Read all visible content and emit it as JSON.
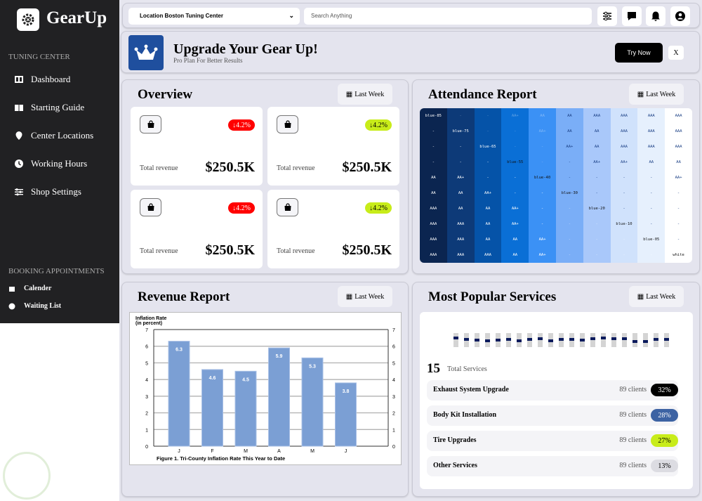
{
  "sidebar": {
    "brand": "GearUp",
    "section1": "TUNING CENTER",
    "items": [
      {
        "label": "Dashboard",
        "icon": "columns-icon"
      },
      {
        "label": "Starting Guide",
        "icon": "book-icon"
      },
      {
        "label": "Center Locations",
        "icon": "map-pin-icon"
      },
      {
        "label": "Working Hours",
        "icon": "clock-icon"
      },
      {
        "label": "Shop Settings",
        "icon": "sliders-icon"
      }
    ],
    "section2": "BOOKING APPOINTMENTS",
    "items2": [
      {
        "label": "Calender",
        "icon": "calendar-icon"
      },
      {
        "label": "Waiting List",
        "icon": "clock-icon"
      }
    ]
  },
  "header": {
    "location": "Location Boston Tuning Center",
    "search_placeholder": "Search Anything"
  },
  "banner": {
    "title": "Upgrade Your Gear Up!",
    "subtitle": "Pro Plan For Better Results",
    "try": "Try Now",
    "close": "X"
  },
  "filter_label": "Last Week",
  "overview": {
    "title": "Overview",
    "cards": [
      {
        "change": "4.2%",
        "color": "#ff0000",
        "text_color": "#ffffff",
        "label": "Total revenue",
        "value": "$250.5K"
      },
      {
        "change": "4.2%",
        "color": "#c8ec1a",
        "text_color": "#000000",
        "label": "Total revenue",
        "value": "$250.5K"
      },
      {
        "change": "4.2%",
        "color": "#ff0000",
        "text_color": "#ffffff",
        "label": "Total revenue",
        "value": "$250.5K"
      },
      {
        "change": "4.2%",
        "color": "#c8ec1a",
        "text_color": "#000000",
        "label": "Total revenue",
        "value": "$250.5K"
      }
    ]
  },
  "attendance": {
    "title": "Attendance Report",
    "column_colors": [
      "#0b2550",
      "#0d3a78",
      "#0553a8",
      "#0a6fd6",
      "#3b91f5",
      "#7aaef7",
      "#a9c8fa",
      "#d0e2fc",
      "#e6f0fd",
      "#ffffff"
    ],
    "rows": [
      [
        "blue-85",
        "-",
        "-",
        "AA+",
        "AA",
        "AA",
        "AAA",
        "AAA",
        "AAA",
        "AAA"
      ],
      [
        "-",
        "blue-75",
        "-",
        "-",
        "AA+",
        "AA",
        "AA",
        "AAA",
        "AAA",
        "AAA"
      ],
      [
        "-",
        "-",
        "blue-65",
        "-",
        "-",
        "AA+",
        "AA",
        "AAA",
        "AAA",
        "AAA"
      ],
      [
        "-",
        "-",
        "-",
        "blue-55",
        "-",
        "-",
        "AA+",
        "AA+",
        "AA",
        "AA"
      ],
      [
        "AA",
        "AA+",
        "-",
        "-",
        "blue-40",
        "-",
        "-",
        "-",
        "-",
        "AA+"
      ],
      [
        "AA",
        "AA",
        "AA+",
        "-",
        "-",
        "blue-30",
        "-",
        "-",
        "-",
        "-"
      ],
      [
        "AAA",
        "AA",
        "AA",
        "AA+",
        "-",
        "-",
        "blue-20",
        "-",
        "-",
        "-"
      ],
      [
        "AAA",
        "AAA",
        "AA",
        "AA+",
        "-",
        "-",
        "-",
        "blue-10",
        "-",
        "-"
      ],
      [
        "AAA",
        "AAA",
        "AA",
        "AA",
        "AA+",
        "-",
        "-",
        "-",
        "blue-05",
        "-"
      ],
      [
        "AAA",
        "AAA",
        "AAA",
        "AA",
        "AA+",
        "-",
        "-",
        "-",
        "-",
        "white"
      ]
    ]
  },
  "revenue": {
    "title": "Revenue Report"
  },
  "chart_data": {
    "type": "bar",
    "title": "Inflation Rate",
    "subtitle": "(in percent)",
    "caption": "Figure 1. Tri-County Inflation Rate This Year to Date",
    "categories": [
      "J",
      "F",
      "M",
      "A",
      "M",
      "J"
    ],
    "values": [
      6.3,
      4.6,
      4.5,
      5.9,
      5.3,
      3.8
    ],
    "ylim": [
      0,
      7
    ],
    "yticks": [
      0,
      1,
      2,
      3,
      4,
      5,
      6,
      7
    ],
    "bar_color": "#7b9fd4",
    "grid": true
  },
  "popular": {
    "title": "Most Popular Services",
    "slider_levels": [
      0.63,
      0.55,
      0.5,
      0.45,
      0.5,
      0.57,
      0.45,
      0.53,
      0.58,
      0.45,
      0.53,
      0.55,
      0.5,
      0.58,
      0.63,
      0.6,
      0.62,
      0.4,
      0.4,
      0.57,
      0.55
    ],
    "total": "15",
    "total_label": "Total Services",
    "services": [
      {
        "name": "Exhaust System Upgrade",
        "clients": "89 clients",
        "pct": "32%",
        "color": "#000000",
        "text_color": "#ffffff"
      },
      {
        "name": "Body Kit Installation",
        "clients": "89 clients",
        "pct": "28%",
        "color": "#3d63a3",
        "text_color": "#ffffff"
      },
      {
        "name": "Tire Upgrades",
        "clients": "89 clients",
        "pct": "27%",
        "color": "#c8ec1a",
        "text_color": "#000000"
      },
      {
        "name": "Other Services",
        "clients": "89 clients",
        "pct": "13%",
        "color": "#dcdce2",
        "text_color": "#000000"
      }
    ]
  }
}
